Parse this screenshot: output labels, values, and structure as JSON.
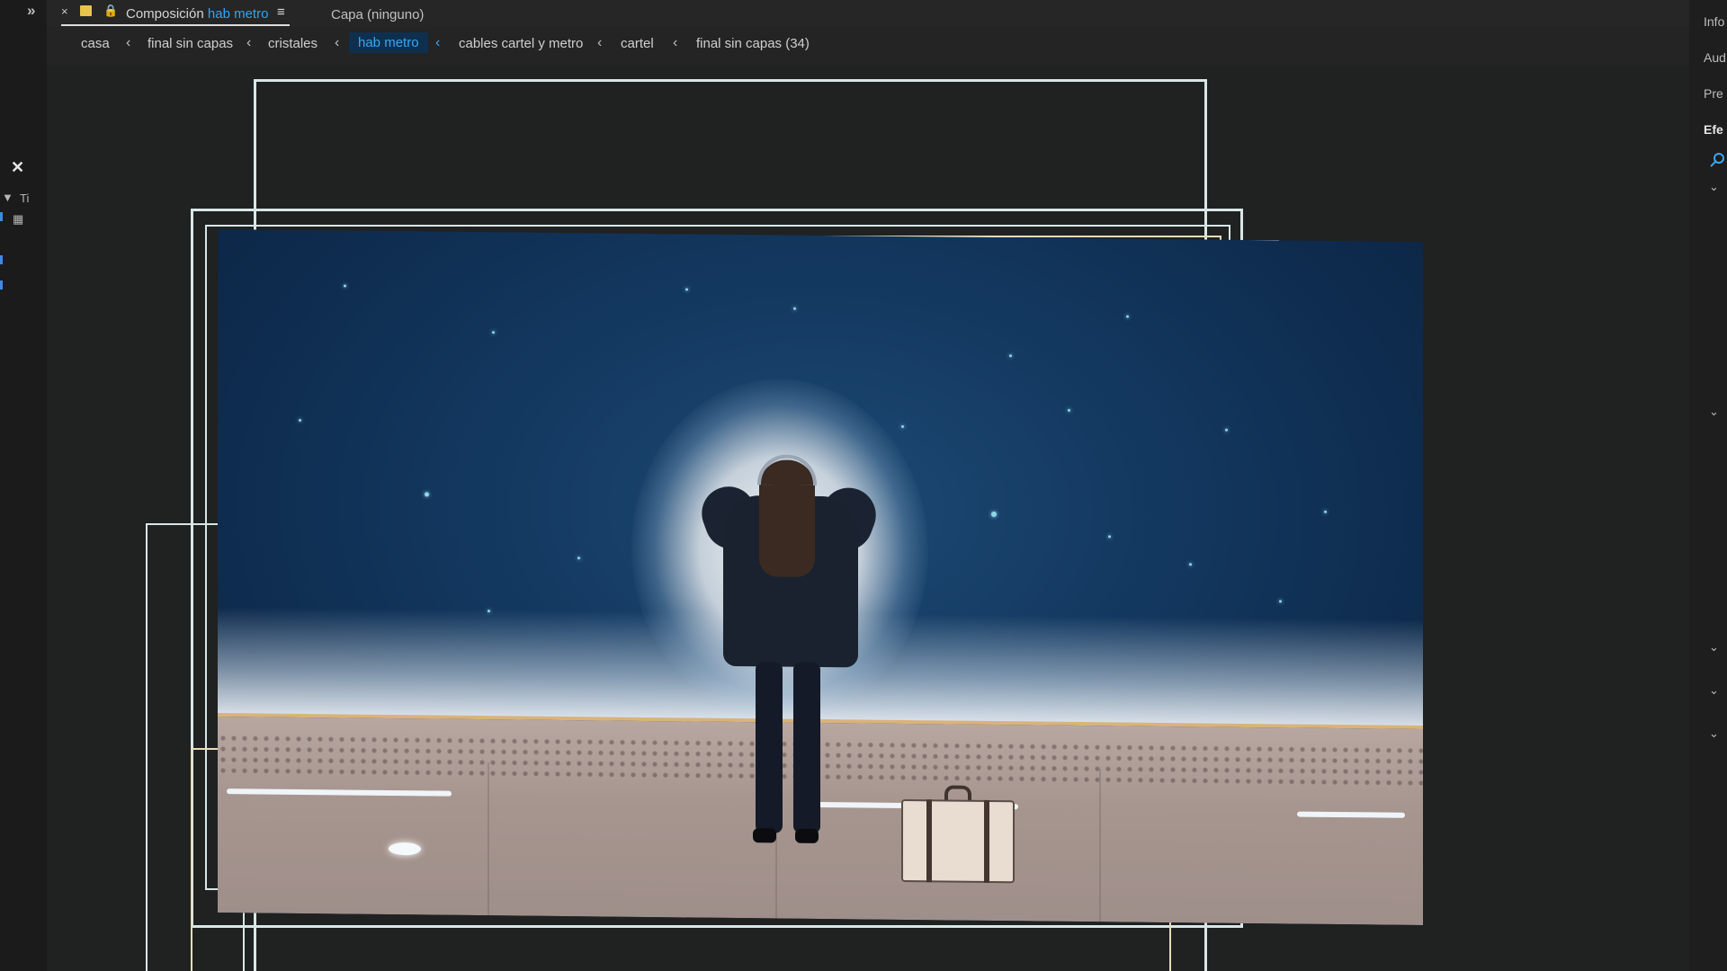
{
  "top_tab": {
    "close_glyph": "×",
    "label_prefix": "Composición",
    "label_highlight": "hab metro",
    "menu_glyph": "≡",
    "layer_label": "Capa (ninguno)"
  },
  "breadcrumbs": {
    "items": [
      "casa",
      "final sin capas",
      "cristales",
      "hab metro",
      "cables cartel y metro",
      "cartel",
      "final sin capas (34)"
    ],
    "separator": "‹"
  },
  "left_panel": {
    "collapse_glyph": "»",
    "close_glyph": "✕",
    "partial_label": "Ti"
  },
  "right_panel": {
    "labels": [
      "Info",
      "Aud",
      "Pre",
      "Efe"
    ]
  },
  "colors": {
    "accent_blue": "#2fa6f2",
    "frame_cyan": "#d9e6e6",
    "frame_yellow": "#e7ddb8"
  }
}
